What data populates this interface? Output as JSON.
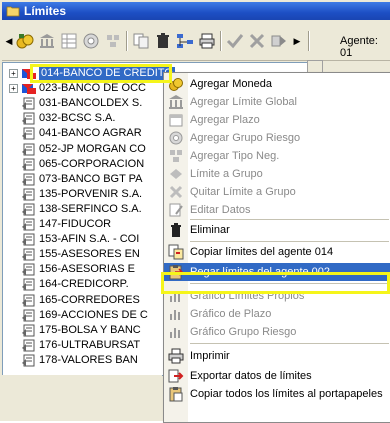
{
  "window": {
    "title": "Límites"
  },
  "toolbar": {
    "agent_label": "Agente: 01",
    "buttons": [
      "house-coins-icon",
      "bank-icon",
      "grid-icon",
      "coin-icon",
      "types-icon",
      "copy-icon",
      "trash-icon",
      "hierarchy-icon",
      "printer-icon",
      "check-icon",
      "cross-icon",
      "arrow-icon"
    ]
  },
  "tree": {
    "items": [
      {
        "label": "014-BANCO DE CREDITO",
        "selected": true,
        "expand": "+"
      },
      {
        "label": "023-BANCO DE OCC",
        "selected": false,
        "expand": "+"
      },
      {
        "label": "031-BANCOLDEX S.",
        "selected": false
      },
      {
        "label": "032-BCSC S.A.",
        "selected": false
      },
      {
        "label": "041-BANCO AGRAR",
        "selected": false
      },
      {
        "label": "052-JP MORGAN CO",
        "selected": false
      },
      {
        "label": "065-CORPORACION",
        "selected": false
      },
      {
        "label": "073-BANCO BGT PA",
        "selected": false
      },
      {
        "label": "135-PORVENIR S.A.",
        "selected": false
      },
      {
        "label": "138-SERFINCO S.A.",
        "selected": false
      },
      {
        "label": "147-FIDUCOR",
        "selected": false
      },
      {
        "label": "153-AFIN S.A. - COI",
        "selected": false
      },
      {
        "label": "155-ASESORES EN",
        "selected": false
      },
      {
        "label": "156-ASESORIAS E",
        "selected": false
      },
      {
        "label": "164-CREDICORP.",
        "selected": false
      },
      {
        "label": "165-CORREDORES",
        "selected": false
      },
      {
        "label": "169-ACCIONES DE C",
        "selected": false
      },
      {
        "label": "175-BOLSA Y BANC",
        "selected": false
      },
      {
        "label": "176-ULTRABURSAT",
        "selected": false
      },
      {
        "label": "178-VALORES BAN",
        "selected": false
      }
    ]
  },
  "context_menu": {
    "items": [
      {
        "label": "Agregar Moneda",
        "icon": "coins-icon",
        "disabled": false
      },
      {
        "label": "Agregar Límite Global",
        "icon": "bank-icon",
        "disabled": true
      },
      {
        "label": "Agregar Plazo",
        "icon": "calendar-icon",
        "disabled": true
      },
      {
        "label": "Agregar Grupo Riesgo",
        "icon": "risk-group-icon",
        "disabled": true
      },
      {
        "label": "Agregar Tipo Neg.",
        "icon": "negotiation-type-icon",
        "disabled": true
      },
      {
        "label": "Límite a Grupo",
        "icon": "limit-group-icon",
        "disabled": true
      },
      {
        "label": "Quitar Límite a Grupo",
        "icon": "remove-limit-icon",
        "disabled": true
      },
      {
        "label": "Editar Datos",
        "icon": "edit-icon",
        "disabled": true
      },
      {
        "label": "Eliminar",
        "icon": "trash-icon",
        "disabled": false
      },
      {
        "label": "Copiar límites del agente 014",
        "icon": "copy-limits-icon",
        "disabled": false
      },
      {
        "label": "Pegar límites del agente 002",
        "icon": "paste-limits-icon",
        "disabled": false,
        "highlighted": true
      },
      {
        "label": "Gráfico Límites Propios",
        "icon": "bar-chart-icon",
        "disabled": true
      },
      {
        "label": "Gráfico de Plazo",
        "icon": "bar-chart-icon",
        "disabled": true
      },
      {
        "label": "Gráfico Grupo Riesgo",
        "icon": "bar-chart-icon",
        "disabled": true
      },
      {
        "label": "Imprimir",
        "icon": "printer-icon",
        "disabled": false
      },
      {
        "label": "Exportar datos de límites",
        "icon": "export-icon",
        "disabled": false
      },
      {
        "label": "Copiar todos los límites al portapapeles",
        "icon": "clipboard-icon",
        "disabled": false
      }
    ]
  },
  "colors": {
    "selection": "#316ac5",
    "highlight_box": "#f5f51a",
    "titlebar": "#1d4fc4"
  }
}
